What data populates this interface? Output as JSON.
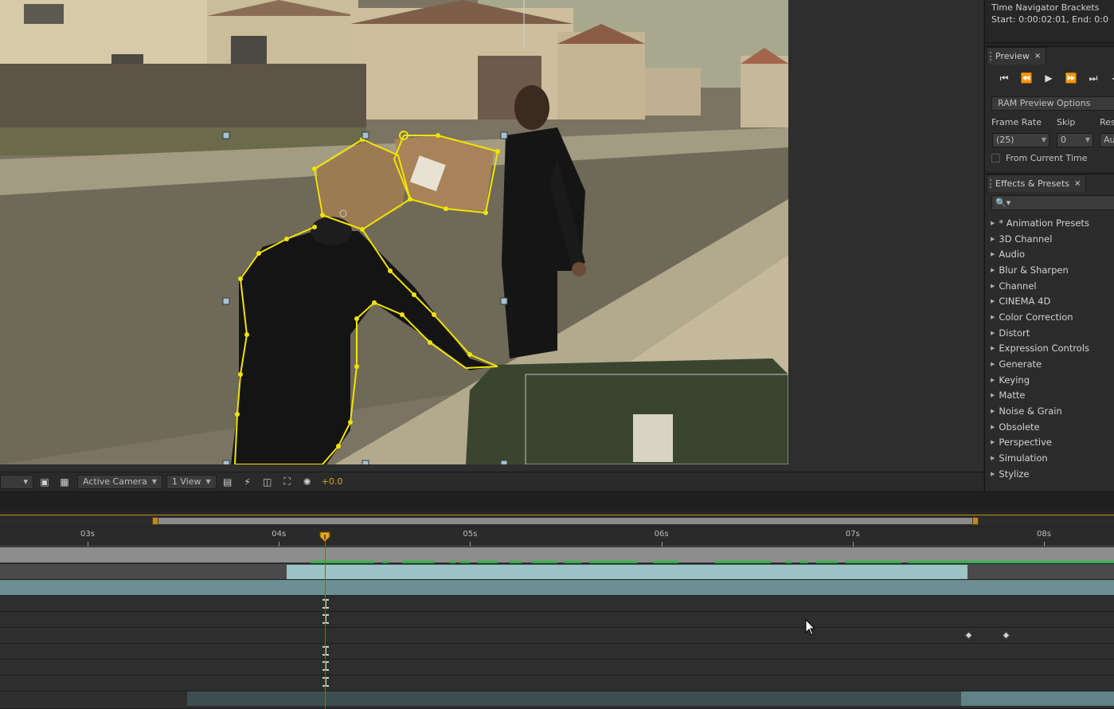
{
  "viewer": {
    "toolbar": {
      "resolution_arrow": "▾",
      "camera": "Active Camera",
      "views": "1 View",
      "exposure": "+0.0"
    }
  },
  "info_panel": {
    "line1": "Time Navigator Brackets",
    "line2": "Start: 0:00:02:01, End: 0:0"
  },
  "preview_panel": {
    "tab_label": "Preview",
    "close": "×",
    "ram_options": "RAM Preview Options",
    "frame_rate_label": "Frame Rate",
    "skip_label": "Skip",
    "res_label": "Res",
    "frame_rate_value": "(25)",
    "skip_value": "0",
    "res_value": "Au",
    "from_current_time": "From Current Time",
    "controls": [
      "⏮",
      "⏪",
      "▶",
      "⏩",
      "⏭",
      "◀"
    ]
  },
  "effects_panel": {
    "tab_label": "Effects & Presets",
    "close": "×",
    "search_placeholder": "🔍▾",
    "items": [
      "* Animation Presets",
      "3D Channel",
      "Audio",
      "Blur & Sharpen",
      "Channel",
      "CINEMA 4D",
      "Color Correction",
      "Distort",
      "Expression Controls",
      "Generate",
      "Keying",
      "Matte",
      "Noise & Grain",
      "Obsolete",
      "Perspective",
      "Simulation",
      "Stylize"
    ]
  },
  "timeline": {
    "ticks": [
      "03s",
      "04s",
      "05s",
      "06s",
      "07s",
      "08s"
    ]
  },
  "colors": {
    "mask": "#f2e300",
    "cti": "#e0352e",
    "cache": "#2fb64a",
    "work_area": "#c08a1b",
    "layer_bar": "#9cc3c6"
  }
}
